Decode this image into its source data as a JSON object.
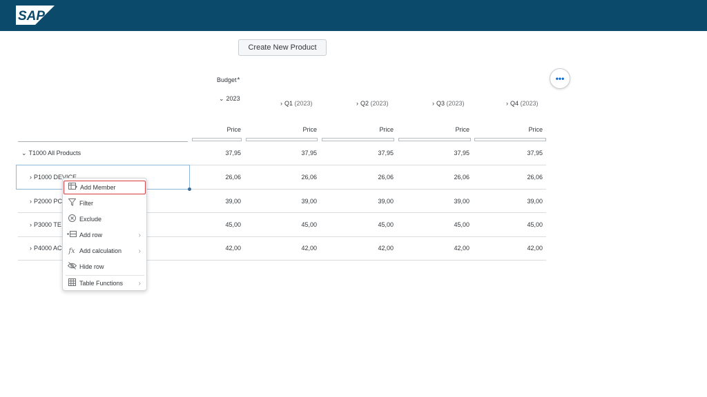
{
  "shell": {
    "logo_text": "SAP",
    "brand_color": "#0b4a6a"
  },
  "toolbar": {
    "create_label": "Create New Product",
    "more_icon": "more-icon"
  },
  "table": {
    "header": {
      "version": "Budget",
      "required_mark": "*",
      "year": "2023",
      "quarters": [
        {
          "label": "Q1",
          "paren": "(2023)"
        },
        {
          "label": "Q2",
          "paren": "(2023)"
        },
        {
          "label": "Q3",
          "paren": "(2023)"
        },
        {
          "label": "Q4",
          "paren": "(2023)"
        }
      ],
      "measure": "Price"
    },
    "rows": [
      {
        "label": "T1000 All Products",
        "values": [
          "37,95",
          "37,95",
          "37,95",
          "37,95",
          "37,95"
        ]
      },
      {
        "label": "P1000 DEVICE",
        "values": [
          "26,06",
          "26,06",
          "26,06",
          "26,06",
          "26,06"
        ]
      },
      {
        "label": "P2000 PC",
        "values": [
          "39,00",
          "39,00",
          "39,00",
          "39,00",
          "39,00"
        ]
      },
      {
        "label": "P3000 TE",
        "values": [
          "45,00",
          "45,00",
          "45,00",
          "45,00",
          "45,00"
        ]
      },
      {
        "label": "P4000 AC",
        "values": [
          "42,00",
          "42,00",
          "42,00",
          "42,00",
          "42,00"
        ]
      }
    ]
  },
  "context_menu": {
    "items": [
      {
        "label": "Add Member",
        "icon": "add-member-icon",
        "submenu": false
      },
      {
        "label": "Filter",
        "icon": "filter-icon",
        "submenu": false
      },
      {
        "label": "Exclude",
        "icon": "exclude-icon",
        "submenu": false
      },
      {
        "label": "Add row",
        "icon": "add-row-icon",
        "submenu": true
      },
      {
        "label": "Add calculation",
        "icon": "fx-icon",
        "submenu": true
      },
      {
        "label": "Hide row",
        "icon": "hide-icon",
        "submenu": false
      },
      {
        "label": "Table Functions",
        "icon": "table-icon",
        "submenu": true
      }
    ]
  }
}
